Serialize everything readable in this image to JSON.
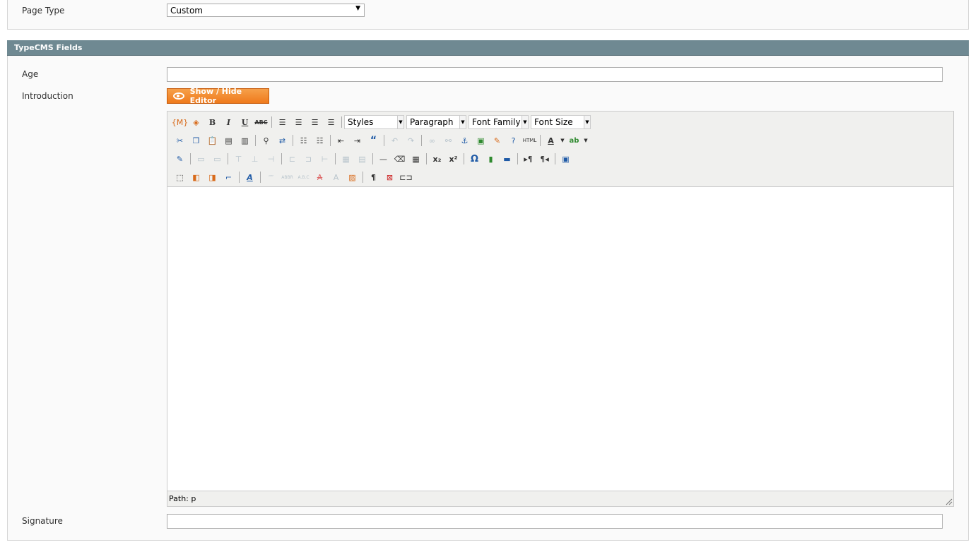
{
  "page_type": {
    "label": "Page Type",
    "value": "Custom"
  },
  "section": {
    "title": "TypeCMS Fields"
  },
  "fields": {
    "age_label": "Age",
    "introduction_label": "Introduction",
    "signature_label": "Signature"
  },
  "editor": {
    "toggle_label": "Show / Hide Editor",
    "styles": "Styles",
    "paragraph": "Paragraph",
    "font_family": "Font Family",
    "font_size": "Font Size",
    "path_label": "Path: p",
    "html_label": "HTML"
  }
}
